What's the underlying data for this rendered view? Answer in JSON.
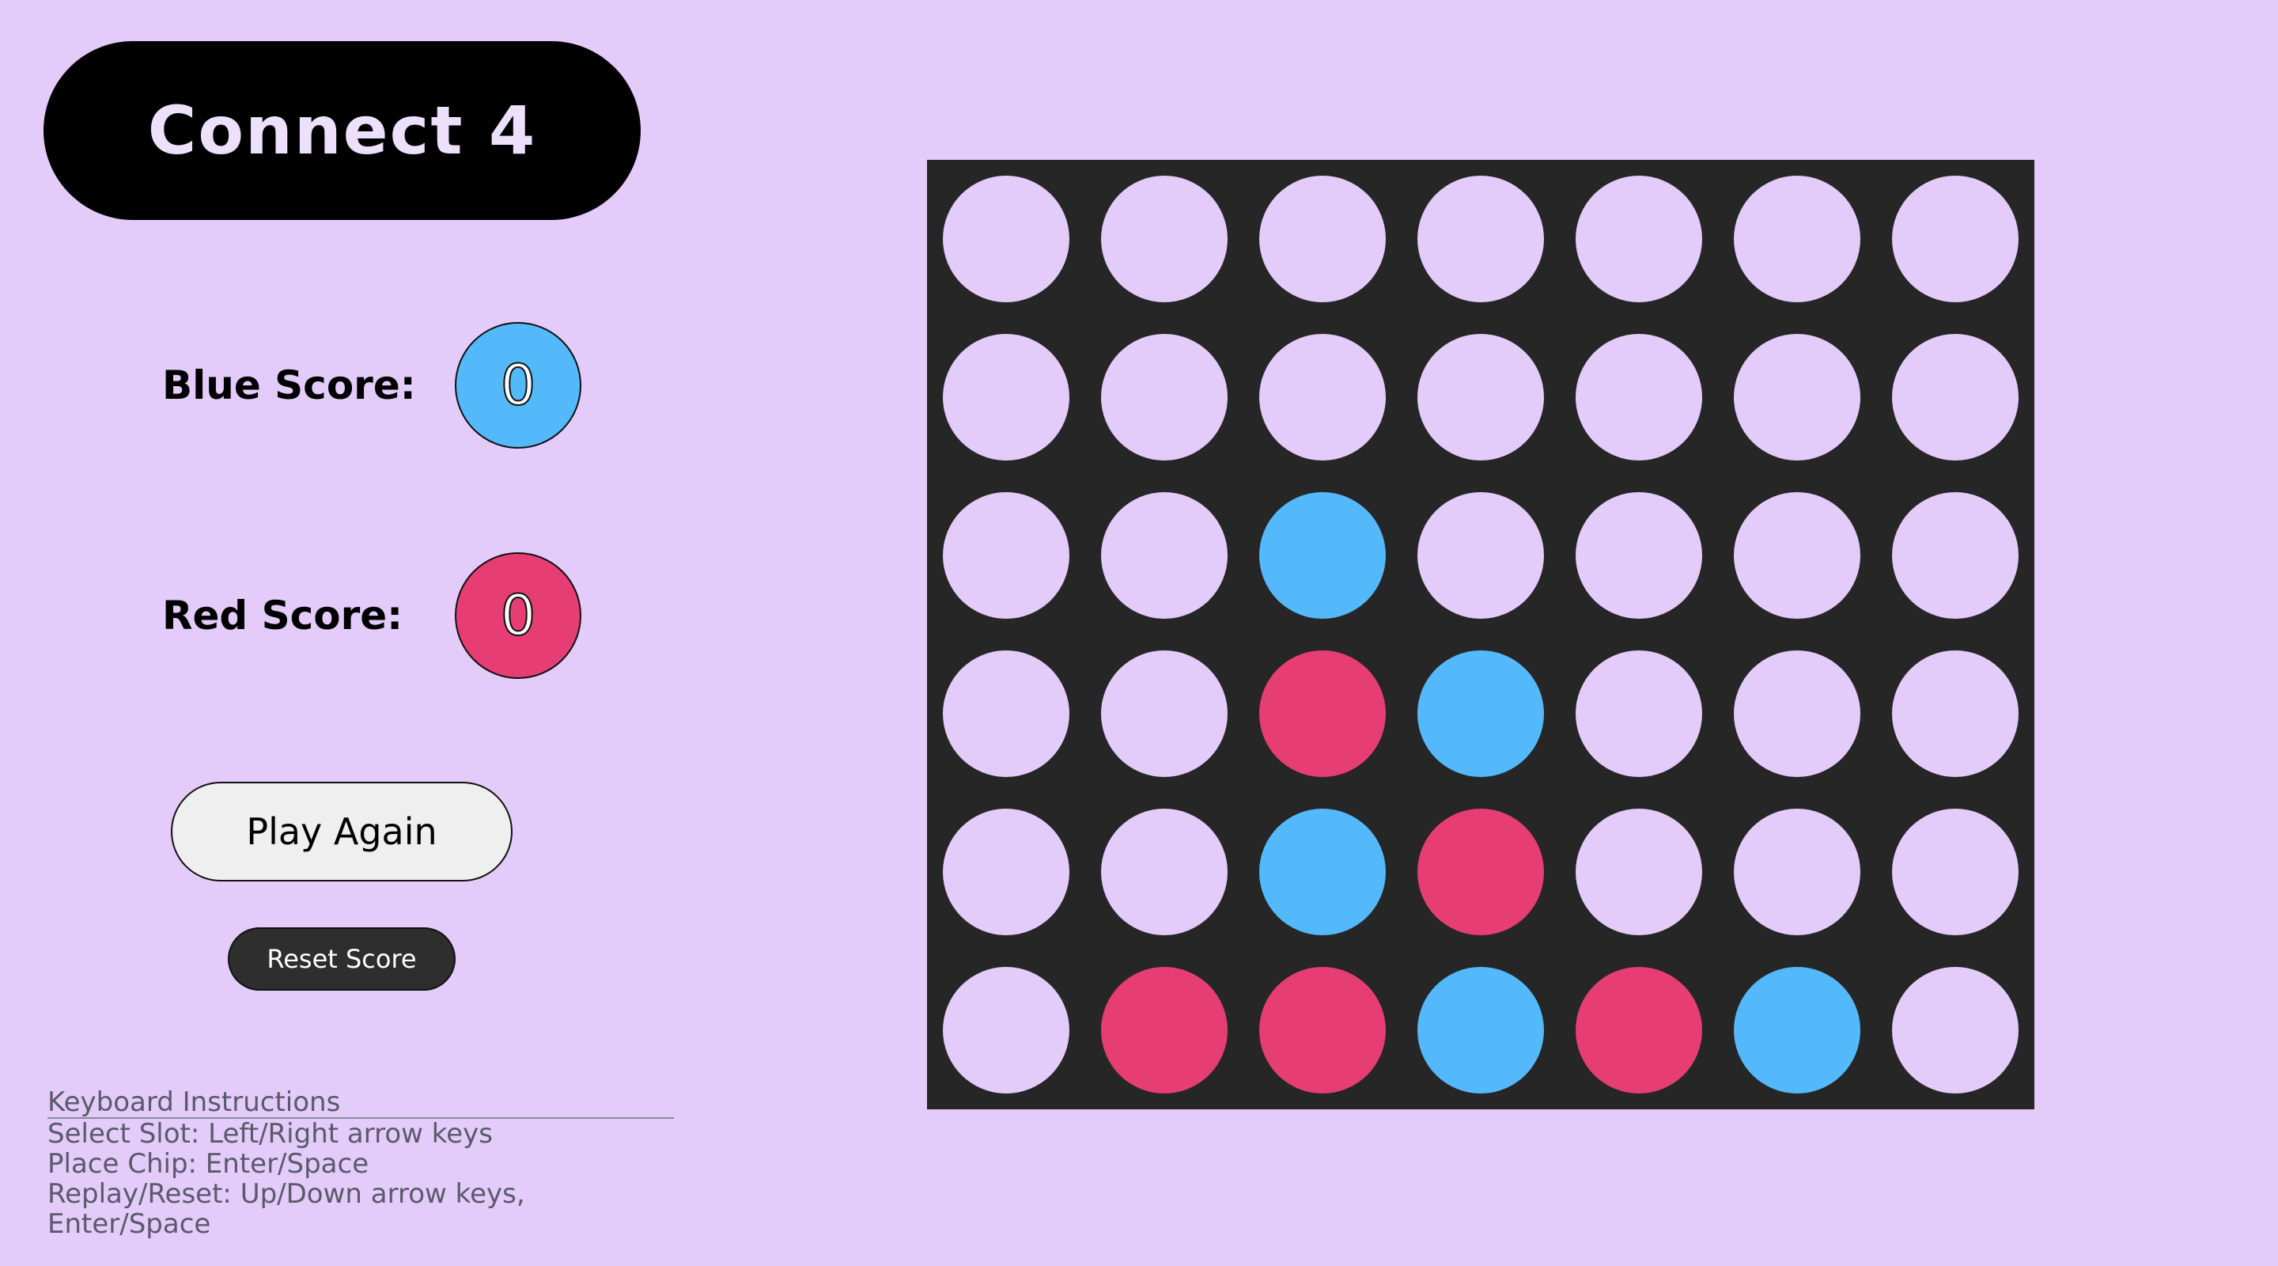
{
  "title": "Connect 4",
  "scores": {
    "blue_label": "Blue Score:",
    "blue_value": "0",
    "red_label": "Red Score:",
    "red_value": "0"
  },
  "buttons": {
    "play_again": "Play Again",
    "reset_score": "Reset Score"
  },
  "instructions": {
    "heading": "Keyboard Instructions",
    "lines": [
      "Select Slot: Left/Right arrow keys",
      "Place Chip: Enter/Space",
      "Replay/Reset: Up/Down arrow keys, Enter/Space"
    ]
  },
  "colors": {
    "background": "#e3cbfa",
    "board": "#262626",
    "empty": "#e3cbfa",
    "blue": "#54b9fa",
    "red": "#e63d74"
  },
  "board": {
    "rows": 6,
    "cols": 7,
    "cells": [
      [
        "empty",
        "empty",
        "empty",
        "empty",
        "empty",
        "empty",
        "empty"
      ],
      [
        "empty",
        "empty",
        "empty",
        "empty",
        "empty",
        "empty",
        "empty"
      ],
      [
        "empty",
        "empty",
        "blue",
        "empty",
        "empty",
        "empty",
        "empty"
      ],
      [
        "empty",
        "empty",
        "red",
        "blue",
        "empty",
        "empty",
        "empty"
      ],
      [
        "empty",
        "empty",
        "blue",
        "red",
        "empty",
        "empty",
        "empty"
      ],
      [
        "empty",
        "red",
        "red",
        "blue",
        "red",
        "blue",
        "empty"
      ]
    ]
  }
}
